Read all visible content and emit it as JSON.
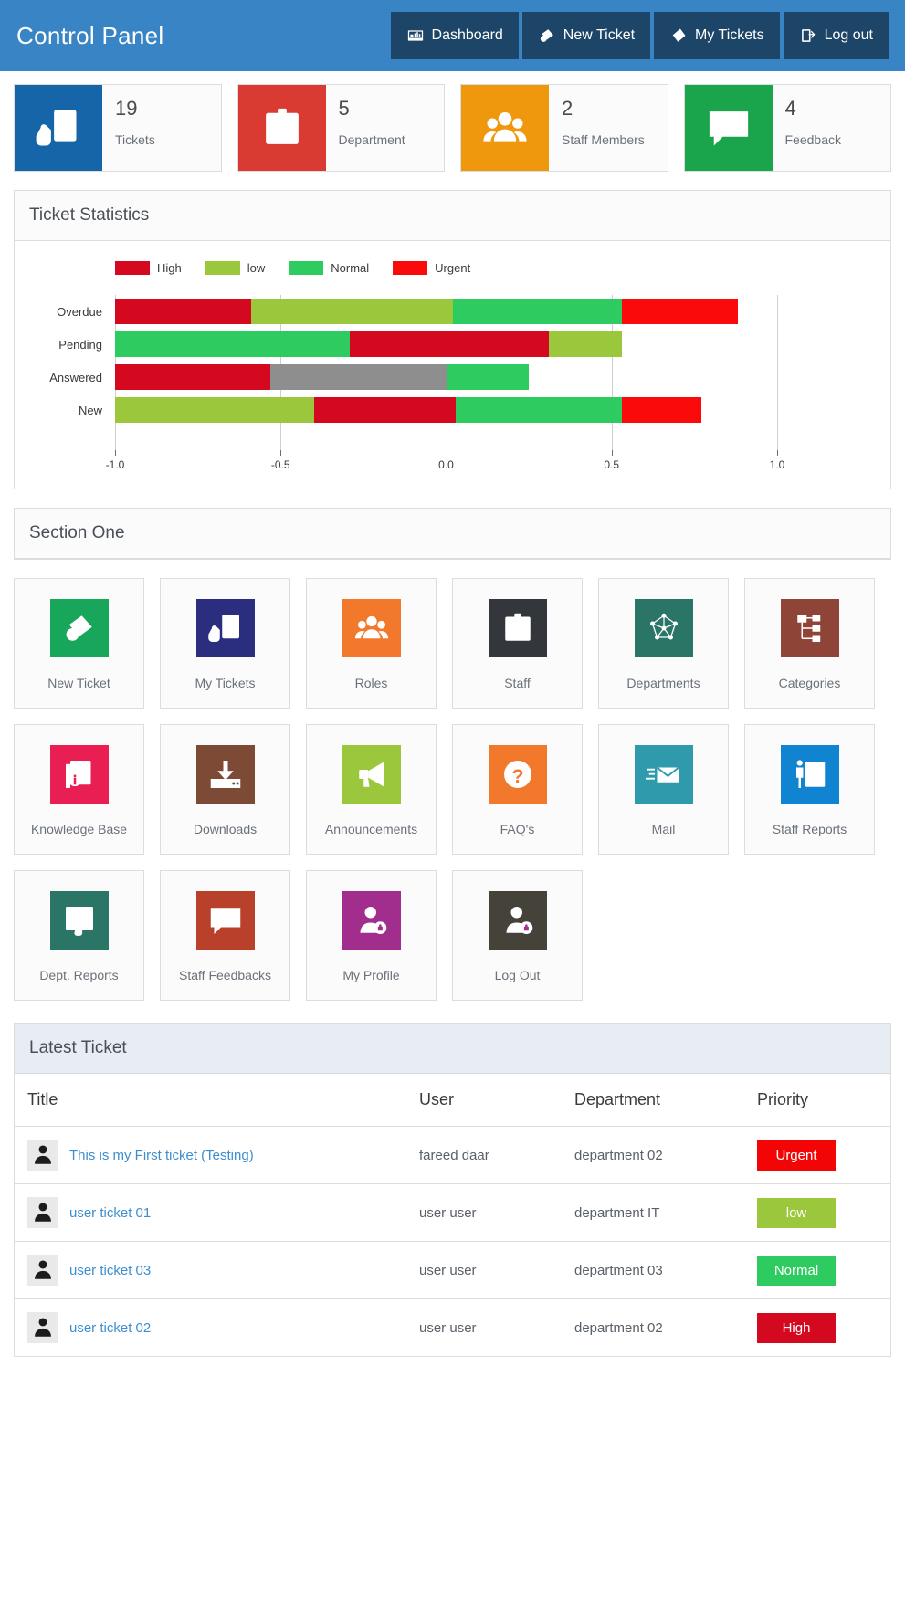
{
  "header": {
    "brand": "Control Panel",
    "brand_bg": "#3884c4",
    "nav_bg": "#1d4567",
    "nav": [
      {
        "label": "Dashboard",
        "icon": "dashboard-icon"
      },
      {
        "label": "New Ticket",
        "icon": "ticket-plus-icon"
      },
      {
        "label": "My Tickets",
        "icon": "ticket-icon"
      },
      {
        "label": "Log out",
        "icon": "logout-icon"
      }
    ]
  },
  "stats": [
    {
      "value": "19",
      "label": "Tickets",
      "color": "#1565a8",
      "icon": "hand-ticket-icon"
    },
    {
      "value": "5",
      "label": "Department",
      "color": "#d93b33",
      "icon": "id-card-icon"
    },
    {
      "value": "2",
      "label": "Staff Members",
      "color": "#f0980d",
      "icon": "people-icon"
    },
    {
      "value": "4",
      "label": "Feedback",
      "color": "#1aa44b",
      "icon": "feedback-icon"
    }
  ],
  "chart_panel": {
    "title": "Ticket Statistics"
  },
  "chart_data": {
    "type": "bar",
    "orientation": "horizontal",
    "stacked": true,
    "title": "Ticket Statistics",
    "xlabel": "",
    "ylabel": "",
    "xlim": [
      -1.0,
      1.0
    ],
    "xticks": [
      "-1.0",
      "-0.5",
      "0.0",
      "0.5",
      "1.0"
    ],
    "xtick_values": [
      -1.0,
      -0.5,
      0.0,
      0.5,
      1.0
    ],
    "grid": true,
    "legend_position": "top-left",
    "categories": [
      "Overdue",
      "Pending",
      "Answered",
      "New"
    ],
    "legend": [
      {
        "name": "High",
        "color": "#d4081f"
      },
      {
        "name": "low",
        "color": "#9ac73c"
      },
      {
        "name": "Normal",
        "color": "#2ecc60"
      },
      {
        "name": "Urgent",
        "color": "#fa0a0a"
      }
    ],
    "series": [
      {
        "name": "High",
        "color": "#d4081f",
        "values": [
          0.41,
          0.43,
          0.47,
          0.4
        ]
      },
      {
        "name": "low",
        "color": "#9ac73c",
        "values": [
          0.75,
          0.14,
          0.0,
          0.47
        ]
      },
      {
        "name": "Normal",
        "color": "#2ecc60",
        "values": [
          0.34,
          0.57,
          0.19,
          0.38
        ]
      },
      {
        "name": "Urgent",
        "color": "#fa0a0a",
        "values": [
          0.2,
          0.0,
          0.0,
          0.19
        ]
      },
      {
        "name": "Other",
        "color": "#8e8e8e",
        "values": [
          0.0,
          0.0,
          0.28,
          0.0
        ]
      }
    ],
    "bars": [
      {
        "category": "Overdue",
        "segments": [
          {
            "series": "High",
            "color": "#d4081f",
            "start": -1.0,
            "end": -0.59
          },
          {
            "series": "low",
            "color": "#9ac73c",
            "start": -0.59,
            "end": 0.02
          },
          {
            "series": "Normal",
            "color": "#2ecc60",
            "start": 0.02,
            "end": 0.53
          },
          {
            "series": "Urgent",
            "color": "#fa0a0a",
            "start": 0.53,
            "end": 0.88
          }
        ]
      },
      {
        "category": "Pending",
        "segments": [
          {
            "series": "Normal",
            "color": "#2ecc60",
            "start": -1.0,
            "end": -0.29
          },
          {
            "series": "High",
            "color": "#d4081f",
            "start": -0.29,
            "end": 0.31
          },
          {
            "series": "low",
            "color": "#9ac73c",
            "start": 0.31,
            "end": 0.53
          }
        ]
      },
      {
        "category": "Answered",
        "segments": [
          {
            "series": "High",
            "color": "#d4081f",
            "start": -1.0,
            "end": -0.53
          },
          {
            "series": "Other",
            "color": "#8e8e8e",
            "start": -0.53,
            "end": 0.0
          },
          {
            "series": "Normal",
            "color": "#2ecc60",
            "start": 0.0,
            "end": 0.25
          }
        ]
      },
      {
        "category": "New",
        "segments": [
          {
            "series": "low",
            "color": "#9ac73c",
            "start": -1.0,
            "end": -0.4
          },
          {
            "series": "High",
            "color": "#d4081f",
            "start": -0.4,
            "end": 0.03
          },
          {
            "series": "Normal",
            "color": "#2ecc60",
            "start": 0.03,
            "end": 0.53
          },
          {
            "series": "Urgent",
            "color": "#fa0a0a",
            "start": 0.53,
            "end": 0.77
          }
        ]
      }
    ]
  },
  "section_one": {
    "title": "Section One"
  },
  "tiles": [
    {
      "label": "New Ticket",
      "color": "#18a65a",
      "icon": "ticket-plus-icon"
    },
    {
      "label": "My Tickets",
      "color": "#2b2e7f",
      "icon": "hand-ticket-icon"
    },
    {
      "label": "Roles",
      "color": "#f2792b",
      "icon": "people-icon"
    },
    {
      "label": "Staff",
      "color": "#33373b",
      "icon": "id-card-icon"
    },
    {
      "label": "Departments",
      "color": "#2b7567",
      "icon": "network-icon"
    },
    {
      "label": "Categories",
      "color": "#8e4436",
      "icon": "sitemap-icon"
    },
    {
      "label": "Knowledge Base",
      "color": "#e91e52",
      "icon": "book-info-icon"
    },
    {
      "label": "Downloads",
      "color": "#7c4a35",
      "icon": "download-icon"
    },
    {
      "label": "Announcements",
      "color": "#9ac73c",
      "icon": "megaphone-icon"
    },
    {
      "label": "FAQ's",
      "color": "#f2792b",
      "icon": "question-icon"
    },
    {
      "label": "Mail",
      "color": "#2e9aab",
      "icon": "mail-icon"
    },
    {
      "label": "Staff Reports",
      "color": "#1083d1",
      "icon": "presenter-icon"
    },
    {
      "label": "Dept. Reports",
      "color": "#2b7567",
      "icon": "report-touch-icon"
    },
    {
      "label": "Staff Feedbacks",
      "color": "#b9412c",
      "icon": "feedback-icon"
    },
    {
      "label": "My Profile",
      "color": "#a12e8c",
      "icon": "user-lock-icon"
    },
    {
      "label": "Log Out",
      "color": "#454239",
      "icon": "user-lock-icon"
    }
  ],
  "latest_ticket": {
    "title": "Latest Ticket",
    "columns": [
      "Title",
      "User",
      "Department",
      "Priority"
    ],
    "rows": [
      {
        "title": "This is my First ticket (Testing)",
        "user": "fareed daar",
        "department": "department 02",
        "priority": "Urgent",
        "priority_color": "#f40505",
        "avatar": "user-avatar-icon"
      },
      {
        "title": "user ticket 01",
        "user": "user user",
        "department": "department IT",
        "priority": "low",
        "priority_color": "#9ac73c",
        "avatar": "user-avatar-icon"
      },
      {
        "title": "user ticket 03",
        "user": "user user",
        "department": "department 03",
        "priority": "Normal",
        "priority_color": "#2ecc60",
        "avatar": "user-avatar-icon"
      },
      {
        "title": "user ticket 02",
        "user": "user user",
        "department": "department 02",
        "priority": "High",
        "priority_color": "#d4081f",
        "avatar": "user-avatar-icon"
      }
    ]
  }
}
